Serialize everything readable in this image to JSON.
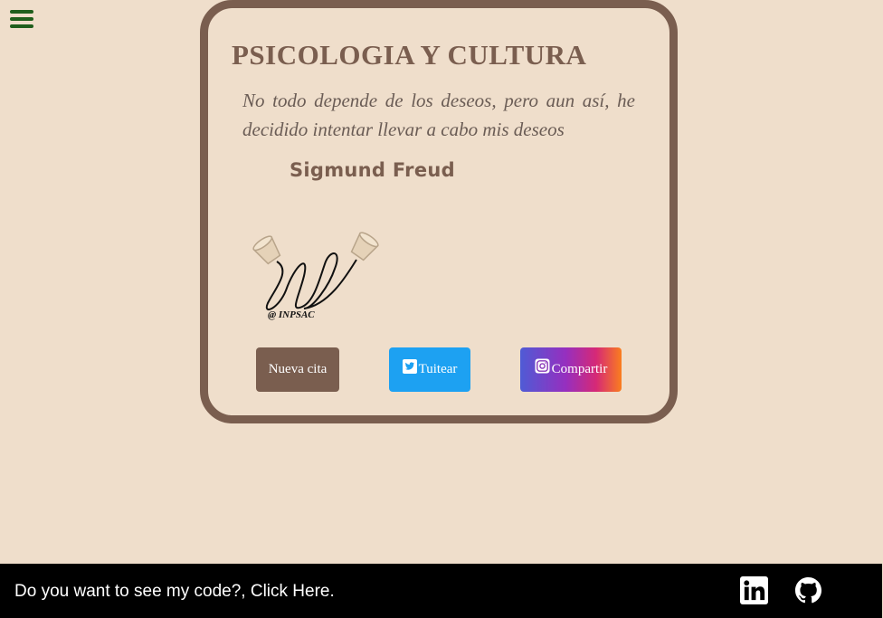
{
  "menu": {
    "icon": "hamburger-menu-icon",
    "color": "#1f5e1c"
  },
  "card": {
    "title": "PSICOLOGIA Y CULTURA",
    "quote": "No todo depende de los deseos, pero aun así, he decidido intentar llevar a cabo mis deseos",
    "author": "Sigmund Freud",
    "logo_text": "@ INPSAC"
  },
  "buttons": {
    "new_quote": "Nueva cita",
    "tweet": "Tuitear",
    "share": "Compartir"
  },
  "footer": {
    "link_text": "Do you want to see my code?, Click Here.",
    "linkedin_icon": "linkedin-icon",
    "github_icon": "github-icon"
  },
  "colors": {
    "background": "#efdecb",
    "card_border": "#7a5e4f",
    "twitter": "#1da1f2",
    "footer": "#000000"
  }
}
